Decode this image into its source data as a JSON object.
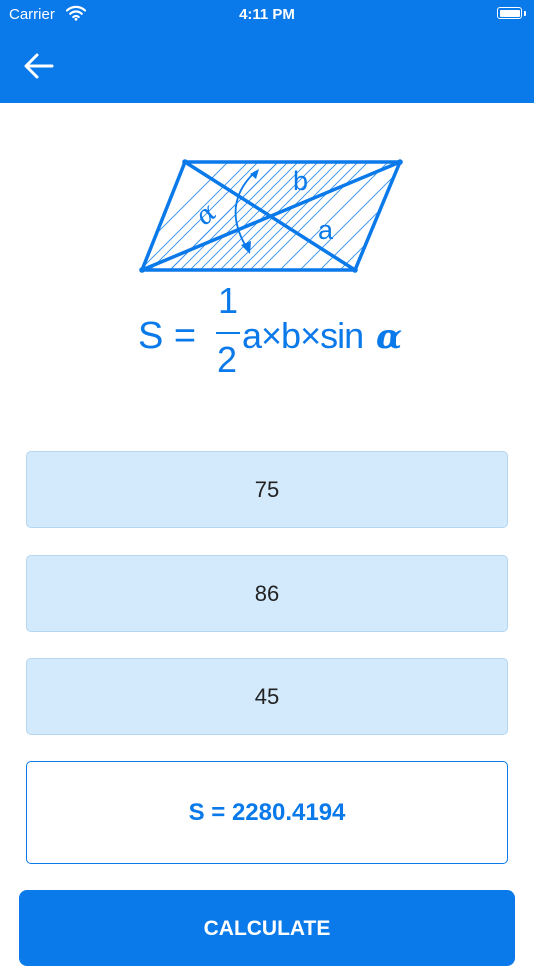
{
  "status_bar": {
    "carrier": "Carrier",
    "time": "4:11 PM"
  },
  "nav": {
    "back_icon": "arrow-left-icon"
  },
  "diagram": {
    "label_b": "b",
    "label_a": "a",
    "label_alpha": "α",
    "formula_lhs": "S =",
    "fraction_numerator": "1",
    "fraction_denominator": "2",
    "formula_rhs": "a×b×sin",
    "formula_alpha": "α"
  },
  "inputs": {
    "side_a": "75",
    "side_b": "86",
    "angle": "45"
  },
  "result": {
    "text": "S = 2280.4194"
  },
  "calculate_button": {
    "label": "CALCULATE"
  },
  "colors": {
    "primary": "#0a79ea",
    "input_bg": "#d3eafd"
  }
}
